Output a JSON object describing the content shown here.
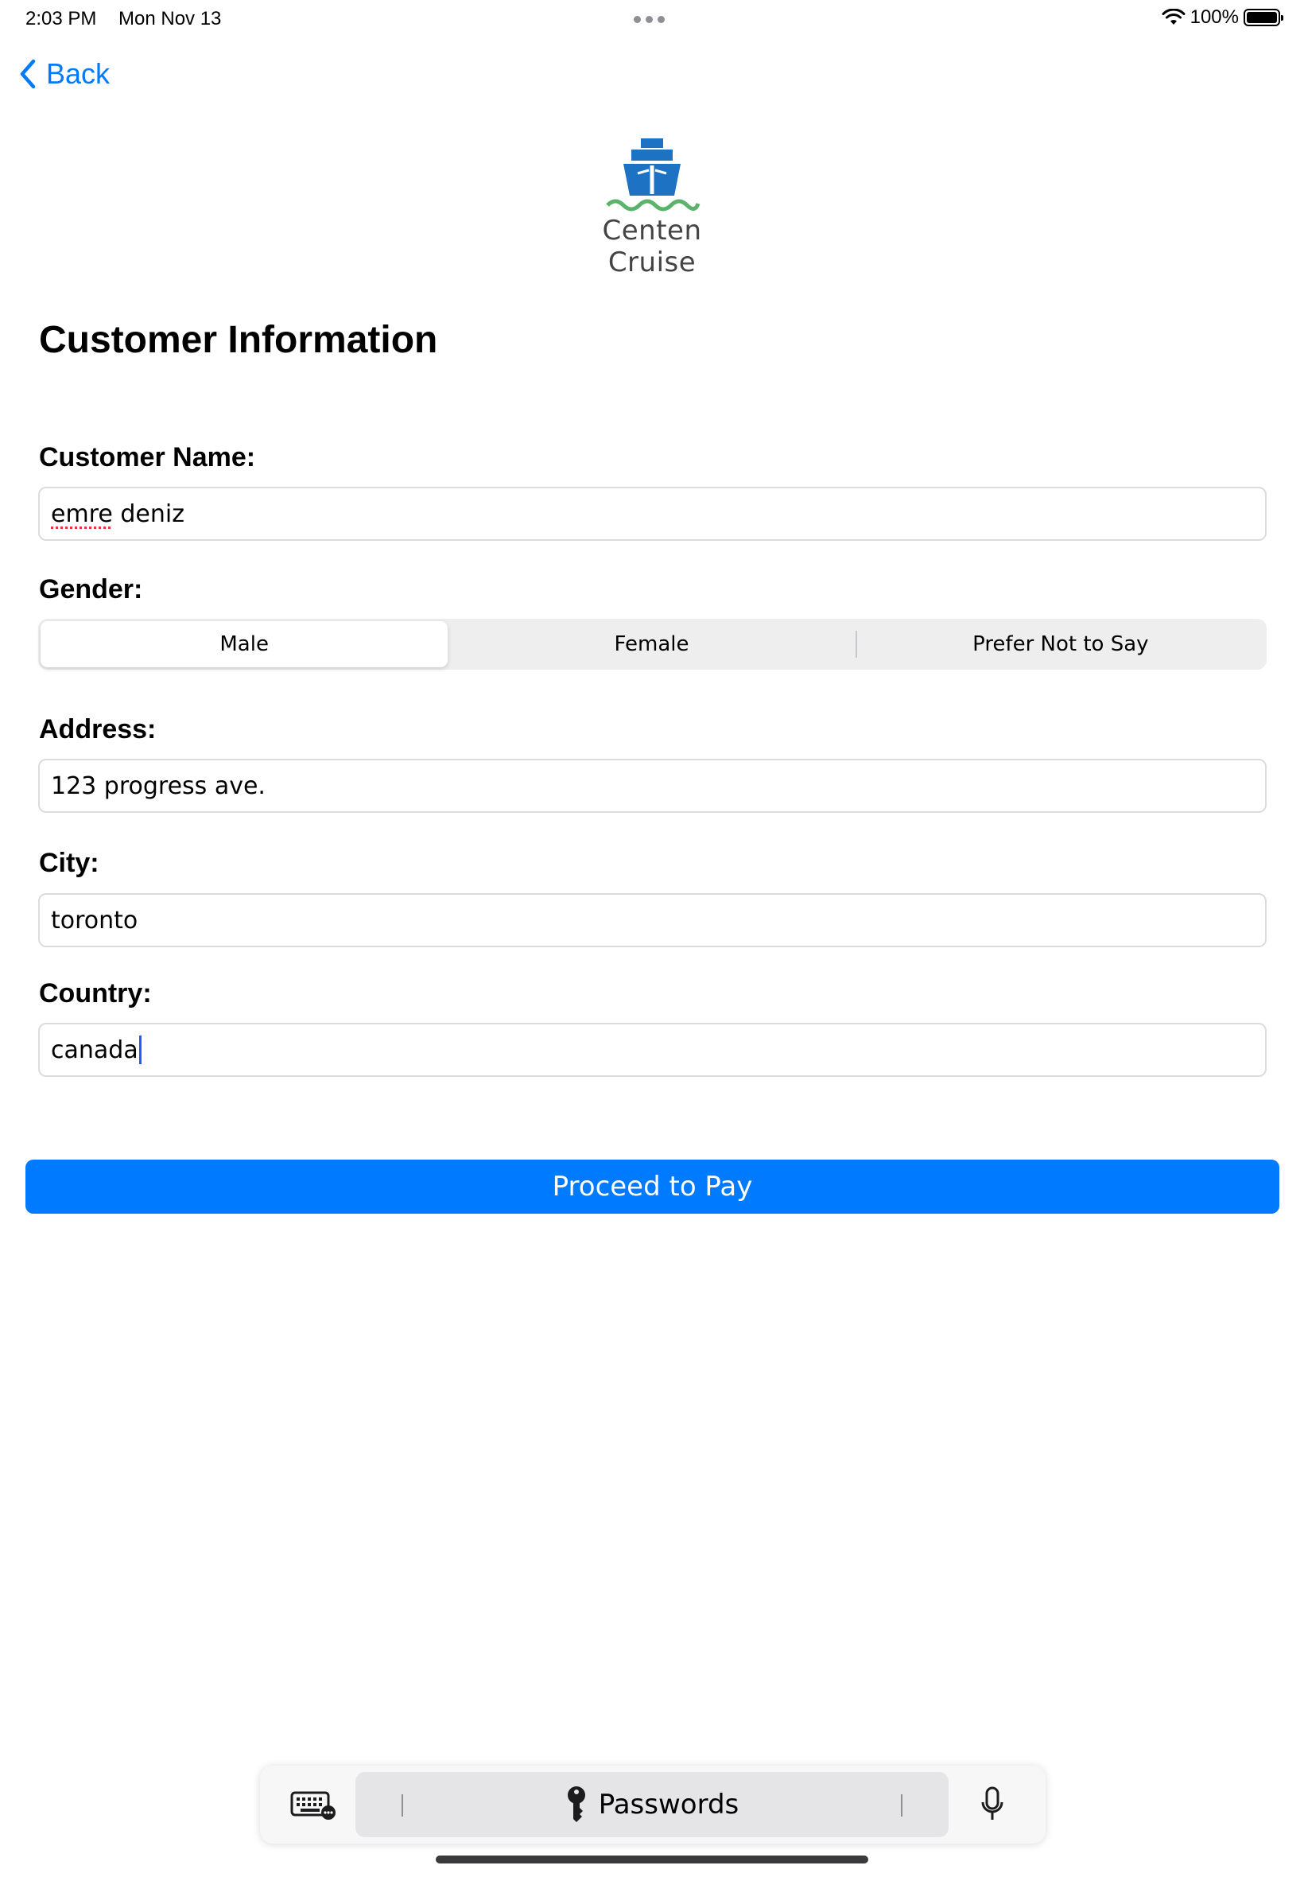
{
  "status_bar": {
    "time": "2:03 PM",
    "date": "Mon Nov 13",
    "battery_percent": "100%",
    "icons": [
      "wifi-icon",
      "battery-icon"
    ]
  },
  "nav": {
    "back_label": "Back",
    "accent_color": "#007aff"
  },
  "brand": {
    "name": "Centen Cruise",
    "logo_icon": "ship-icon",
    "logo_colors": [
      "#1e72c4",
      "#5bb36a"
    ]
  },
  "form": {
    "title": "Customer Information",
    "customer_name": {
      "label": "Customer Name:",
      "value_misspelled": "emre",
      "value_rest": " deniz"
    },
    "gender": {
      "label": "Gender:",
      "options": [
        "Male",
        "Female",
        "Prefer Not to Say"
      ],
      "selected": "Male"
    },
    "address": {
      "label": "Address:",
      "value": "123 progress ave."
    },
    "city": {
      "label": "City:",
      "value": "toronto"
    },
    "country": {
      "label": "Country:",
      "value": "canada"
    },
    "submit_label": "Proceed to Pay"
  },
  "keyboard_bar": {
    "passwords_label": "Passwords",
    "icons": [
      "keyboard-icon",
      "key-icon",
      "microphone-icon"
    ]
  }
}
